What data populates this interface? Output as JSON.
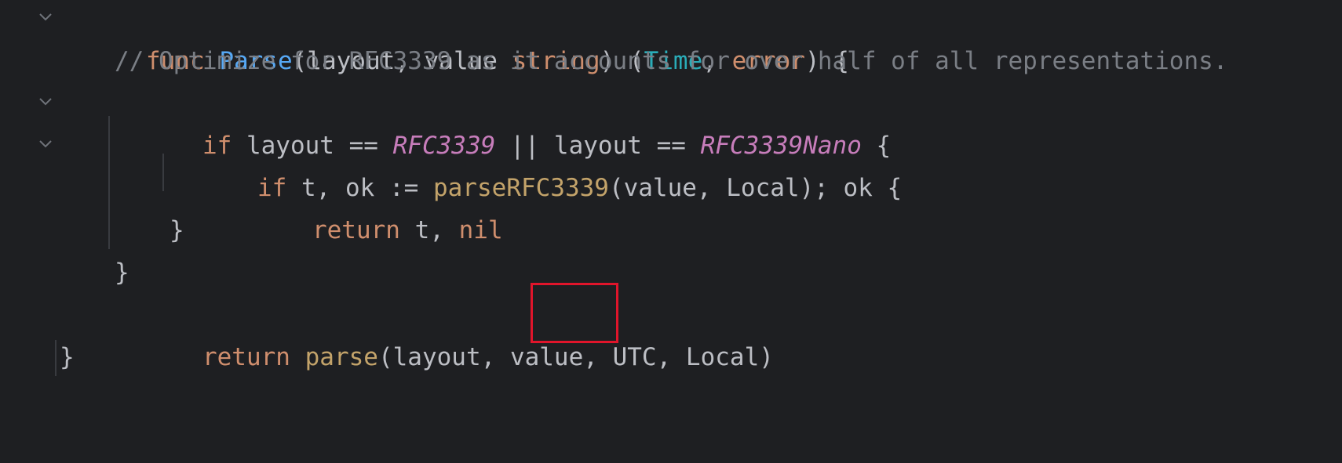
{
  "editor": {
    "lines": [
      {
        "kw": "func ",
        "fn": "Parse",
        "p1": "(layout, value ",
        "t_string": "string",
        "p2": ") (",
        "t_time": "Time",
        "p3": ", ",
        "t_error": "error",
        "p4": ") {"
      },
      {
        "comment": "// Optimize for RFC3339 as it accounts for over half of all representations."
      },
      {
        "kw": "if ",
        "p1": "layout == ",
        "c1": "RFC3339",
        "p2": " || layout == ",
        "c2": "RFC3339Nano",
        "p3": " {"
      },
      {
        "kw": "if ",
        "p1": "t, ok := ",
        "call": "parseRFC3339",
        "p2": "(value, Local); ok {"
      },
      {
        "kw": "return ",
        "p1": "t, ",
        "kw2": "nil"
      },
      {
        "p1": "}"
      },
      {
        "p1": "}"
      },
      {
        "kw": "return ",
        "call": "parse",
        "p1": "(layout, value, ",
        "hl": "UTC,",
        "p2": " Local)"
      },
      {
        "p1": "}"
      }
    ]
  },
  "colors": {
    "background": "#1e1f22",
    "keyword": "#cf8e6d",
    "function": "#56a8f5",
    "type": "#2aacb8",
    "comment": "#7a7e85",
    "constant": "#c77dbb",
    "call": "#c3a36a",
    "text": "#bcbec4",
    "highlight_box": "#e0152b"
  },
  "icons": {
    "fold": "chevron-down-icon"
  }
}
